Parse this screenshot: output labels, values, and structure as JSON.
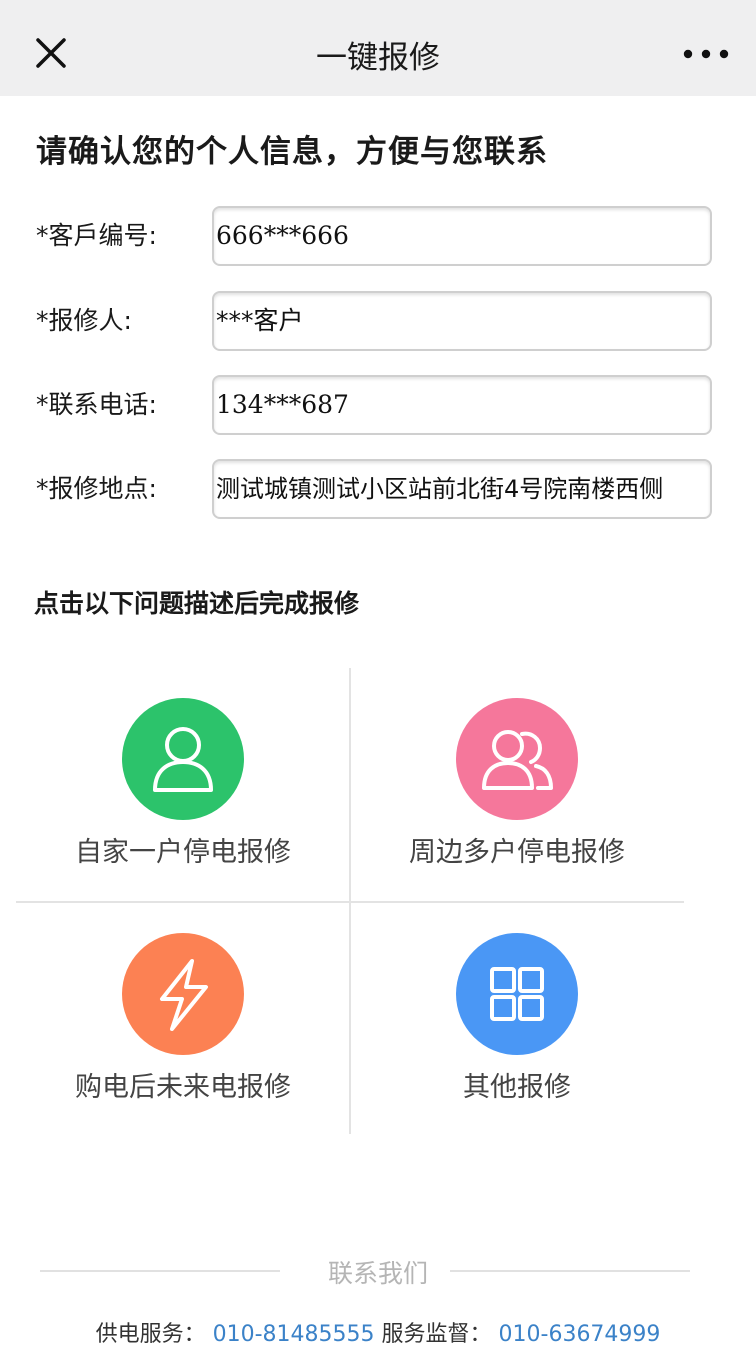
{
  "header": {
    "title": "一键报修",
    "close_icon": "close-icon",
    "more_icon": "more-dots-icon"
  },
  "info": {
    "heading": "请确认您的个人信息，方便与您联系",
    "fields": [
      {
        "label": "*客戶编号:",
        "value": "666***666"
      },
      {
        "label": "*报修人:",
        "value": "***客户"
      },
      {
        "label": "*联系电话:",
        "value": "134***687"
      },
      {
        "label": "*报修地点:",
        "value": "测试城镇测试小区站前北街4号院南楼西侧"
      }
    ]
  },
  "issues": {
    "heading": "点击以下问题描述后完成报修",
    "options": [
      {
        "label": "自家一户停电报修",
        "icon": "person-icon",
        "color": "#2cc36b"
      },
      {
        "label": "周边多户停电报修",
        "icon": "people-icon",
        "color": "#f5779b"
      },
      {
        "label": "购电后未来电报修",
        "icon": "lightning-icon",
        "color": "#fc8153"
      },
      {
        "label": "其他报修",
        "icon": "grid-icon",
        "color": "#4a97f5"
      }
    ]
  },
  "contact": {
    "title": "联系我们",
    "supply_label": "供电服务：",
    "supply_phone": "010-81485555",
    "supervise_label": "服务监督：",
    "supervise_phone": "010-63674999"
  }
}
